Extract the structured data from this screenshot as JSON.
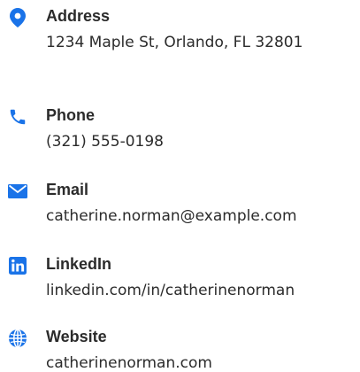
{
  "accent_color": "#1a73e8",
  "contacts": [
    {
      "icon": "map-marker-icon",
      "label": "Address",
      "value": "1234 Maple St, Orlando, FL 32801"
    },
    {
      "icon": "phone-icon",
      "label": "Phone",
      "value": "(321) 555-0198"
    },
    {
      "icon": "envelope-icon",
      "label": "Email",
      "value": "catherine.norman@example.com"
    },
    {
      "icon": "linkedin-icon",
      "label": "LinkedIn",
      "value": "linkedin.com/in/catherinenorman"
    },
    {
      "icon": "globe-icon",
      "label": "Website",
      "value": "catherinenorman.com"
    }
  ]
}
